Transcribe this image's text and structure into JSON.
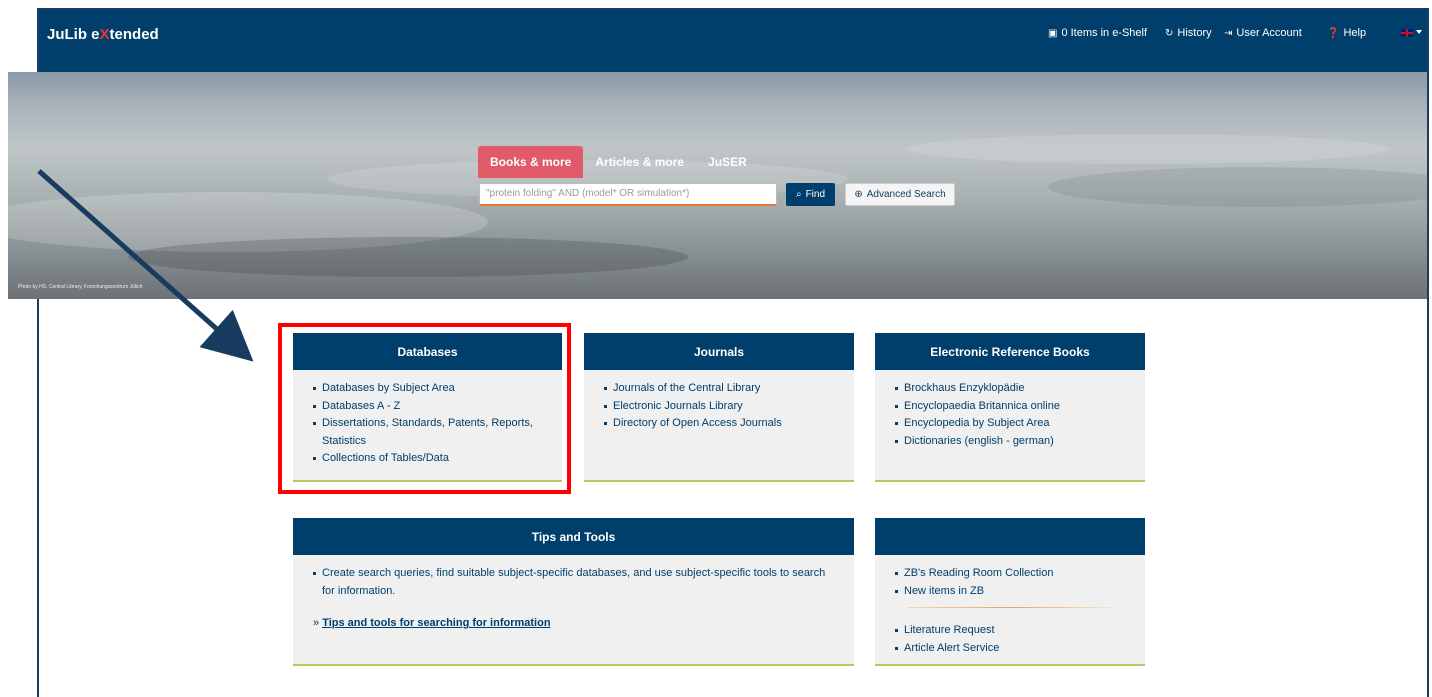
{
  "brand": {
    "prefix": "JuLib e",
    "x": "X",
    "suffix": "tended"
  },
  "nav": {
    "eshelf": "0 Items in e-Shelf",
    "history": "History",
    "account": "User Account",
    "help": "Help"
  },
  "hero": {
    "photo_credit": "Photo by HS. Central Library, Forschungszentrum Jülich"
  },
  "search": {
    "tabs": [
      "Books & more",
      "Articles & more",
      "JuSER"
    ],
    "active_tab": "Books & more",
    "placeholder": "\"protein folding\" AND (model* OR simulation*)",
    "find_label": "Find",
    "advanced_label": "Advanced Search"
  },
  "cards": {
    "databases": {
      "title": "Databases",
      "items": [
        "Databases by Subject Area",
        "Databases A - Z",
        "Dissertations, Standards, Patents, Reports, Statistics",
        "Collections of Tables/Data"
      ]
    },
    "journals": {
      "title": "Journals",
      "items": [
        "Journals of the Central Library",
        "Electronic Journals Library",
        "Directory of Open Access Journals"
      ]
    },
    "reference": {
      "title": "Electronic Reference Books",
      "items": [
        "Brockhaus Enzyklopädie",
        "Encyclopaedia Britannica online",
        "Encyclopedia by Subject Area",
        "Dictionaries (english - german)"
      ]
    },
    "tips": {
      "title": "Tips and Tools",
      "items": [
        "Create search queries, find suitable subject-specific databases, and use subject-specific tools to search for information."
      ],
      "link_prefix": "»",
      "link_label": "Tips and tools for searching for information"
    },
    "services": {
      "title": "",
      "items_top": [
        "ZB's Reading Room Collection",
        "New items in ZB"
      ],
      "items_bottom": [
        "Literature Request",
        "Article Alert Service"
      ]
    }
  },
  "colors": {
    "navbar": "#003e6b",
    "active_tab": "#e05a6a",
    "highlight": "#ff0000",
    "card_underline": "#b5c95a"
  },
  "icons": [
    "briefcase-icon",
    "history-icon",
    "sign-in-icon",
    "help-icon",
    "uk-flag-icon",
    "search-icon",
    "zoom-icon"
  ]
}
